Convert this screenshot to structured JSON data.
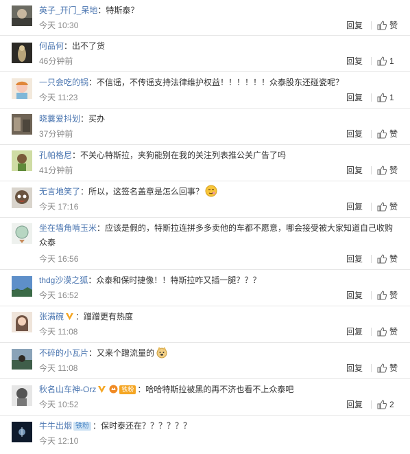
{
  "reply_label": "回复",
  "like_label": "赞",
  "comments": [
    {
      "user": "英子_开门_呆地",
      "text": "：特斯泰？",
      "time": "今天 10:30",
      "likes": ""
    },
    {
      "user": "何品何",
      "text": "：出不了货",
      "time": "46分钟前",
      "likes": "1"
    },
    {
      "user": "一只会吃的锅",
      "text": "：不信谣，不传谣支持法律维护权益！！！！！！众泰股东还碰瓷呢？",
      "time": "今天 11:23",
      "likes": "1"
    },
    {
      "user": "晓蘘爱抖划",
      "text": "：买办",
      "time": "37分钟前",
      "likes": ""
    },
    {
      "user": "孔帕格尼",
      "text": "：不关心特斯拉，夹狗能别在我的关注列表推公关广告了吗",
      "time": "41分钟前",
      "likes": ""
    },
    {
      "user": "无言地笑了",
      "text": "：所以，这签名盖章是怎么回事？",
      "time": "今天 17:16",
      "likes": ""
    },
    {
      "user": "坐在墙角啃玉米",
      "text": "：应该是假的，特斯拉连拼多多卖他的车都不愿意，哪会接受被大家知道自己收购众泰",
      "time": "今天 16:56",
      "likes": ""
    },
    {
      "user": "thdg沙漠之狐",
      "text": "：众泰和保时捷像！！特斯拉咋又插一腿？？？",
      "time": "今天 16:52",
      "likes": ""
    },
    {
      "user": "张满碗",
      "text": "：蹭蹭更有热度",
      "time": "今天 11:08",
      "likes": ""
    },
    {
      "user": "不碎的小瓦片",
      "text": "：又来个蹭流量的",
      "time": "今天 11:08",
      "likes": ""
    },
    {
      "user": "秋名山车神-Orz",
      "text": "：哈哈特斯拉被黑的再不济也看不上众泰吧",
      "time": "今天 10:52",
      "likes": "2",
      "badge": "铁粉"
    },
    {
      "user": "牛牛出烟",
      "text": "：保时泰还在？？？？？？",
      "time": "今天 12:10",
      "likes": "",
      "badge": "铁粉"
    }
  ]
}
